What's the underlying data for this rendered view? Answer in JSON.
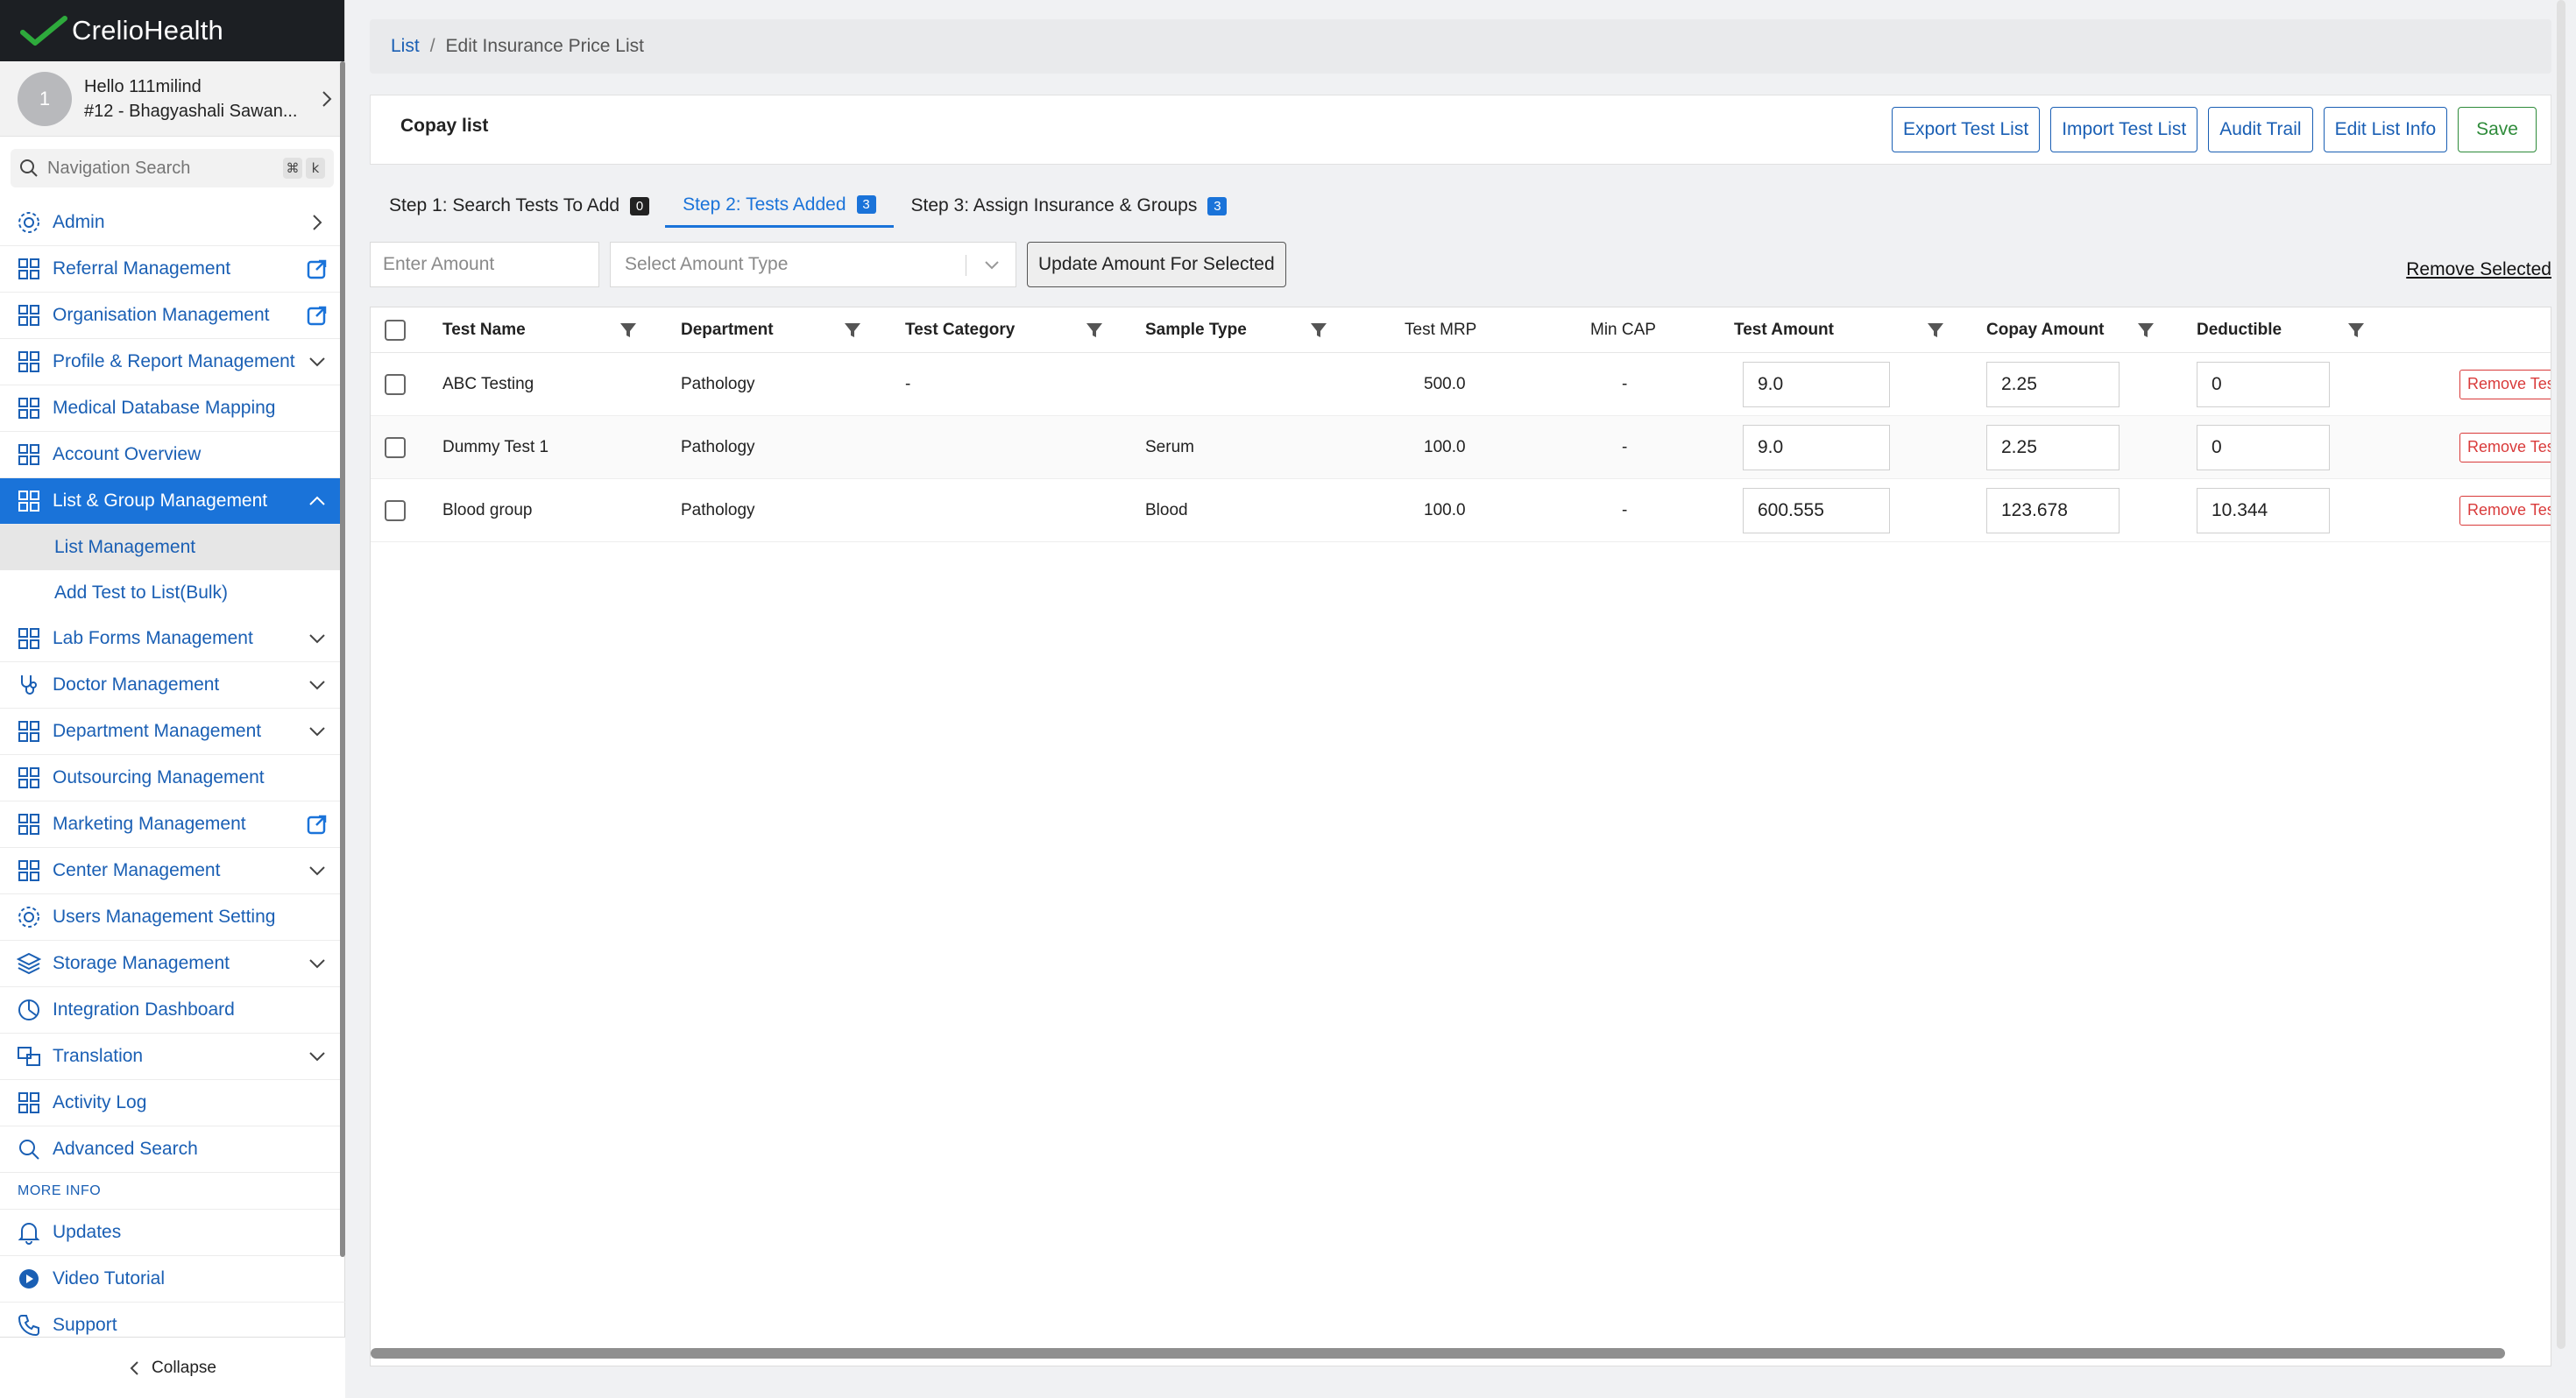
{
  "app": {
    "brand_name": "CrelioHealth",
    "brand_color": "#2eaa3c",
    "accent_color": "#1a73d9"
  },
  "user": {
    "avatar_initial": "1",
    "greeting": "Hello 111milind",
    "center": "#12 - Bhagyashali Sawan..."
  },
  "nav_search": {
    "placeholder": "Navigation Search",
    "key1": "⌘",
    "key2": "k"
  },
  "sidebar": {
    "items": [
      {
        "label": "Admin",
        "icon": "gear-icon",
        "trail": "chevron-right"
      },
      {
        "label": "Referral Management",
        "icon": "grid-icon",
        "trail": "external-link"
      },
      {
        "label": "Organisation Management",
        "icon": "grid-icon",
        "trail": "external-link"
      },
      {
        "label": "Profile & Report Management",
        "icon": "grid-icon",
        "trail": "chevron-down"
      },
      {
        "label": "Medical Database Mapping",
        "icon": "grid-icon",
        "trail": ""
      },
      {
        "label": "Account Overview",
        "icon": "grid-icon",
        "trail": ""
      },
      {
        "label": "List & Group Management",
        "icon": "grid-icon",
        "trail": "chevron-up"
      }
    ],
    "sub_items": [
      {
        "label": "List Management"
      },
      {
        "label": "Add Test to List(Bulk)"
      }
    ],
    "items2": [
      {
        "label": "Lab Forms Management",
        "icon": "grid-icon",
        "trail": "chevron-down"
      },
      {
        "label": "Doctor Management",
        "icon": "stethoscope-icon",
        "trail": "chevron-down"
      },
      {
        "label": "Department Management",
        "icon": "grid-icon",
        "trail": "chevron-down"
      },
      {
        "label": "Outsourcing Management",
        "icon": "grid-icon",
        "trail": ""
      },
      {
        "label": "Marketing Management",
        "icon": "grid-icon",
        "trail": "external-link"
      },
      {
        "label": "Center Management",
        "icon": "grid-icon",
        "trail": "chevron-down"
      },
      {
        "label": "Users Management Setting",
        "icon": "gear-icon",
        "trail": ""
      },
      {
        "label": "Storage Management",
        "icon": "layers-icon",
        "trail": "chevron-down"
      },
      {
        "label": "Integration Dashboard",
        "icon": "dashboard-icon",
        "trail": ""
      },
      {
        "label": "Translation",
        "icon": "translate-icon",
        "trail": "chevron-down"
      },
      {
        "label": "Activity Log",
        "icon": "grid-icon",
        "trail": ""
      },
      {
        "label": "Advanced Search",
        "icon": "search-icon",
        "trail": ""
      }
    ],
    "more_info_label": "MORE INFO",
    "more_items": [
      {
        "label": "Updates",
        "icon": "bell-icon"
      },
      {
        "label": "Video Tutorial",
        "icon": "play-icon"
      },
      {
        "label": "Support",
        "icon": "phone-icon"
      }
    ],
    "collapse_label": "Collapse"
  },
  "breadcrumb": {
    "link": "List",
    "separator": "/",
    "current": "Edit Insurance Price List"
  },
  "header": {
    "title": "Copay list",
    "buttons": {
      "export": "Export Test List",
      "import": "Import Test List",
      "audit": "Audit Trail",
      "edit": "Edit List Info",
      "save": "Save"
    }
  },
  "tabs": [
    {
      "label": "Step 1: Search Tests To Add",
      "badge": "0"
    },
    {
      "label": "Step 2: Tests Added",
      "badge": "3"
    },
    {
      "label": "Step 3: Assign Insurance & Groups",
      "badge": "3"
    }
  ],
  "toolbar": {
    "amount_placeholder": "Enter Amount",
    "amount_type_placeholder": "Select Amount Type",
    "update_label": "Update Amount For Selected",
    "remove_selected_label": "Remove Selected"
  },
  "table": {
    "headers": {
      "test_name": "Test Name",
      "department": "Department",
      "test_category": "Test Category",
      "sample_type": "Sample Type",
      "test_mrp": "Test MRP",
      "min_cap": "Min CAP",
      "test_amount": "Test Amount",
      "copay_amount": "Copay Amount",
      "deductible": "Deductible"
    },
    "remove_label": "Remove Test",
    "rows": [
      {
        "name": "ABC Testing",
        "department": "Pathology",
        "category": "-",
        "sample": "",
        "mrp": "500.0",
        "min_cap": "-",
        "test_amount": "9.0",
        "copay_amount": "2.25",
        "deductible": "0"
      },
      {
        "name": "Dummy Test 1",
        "department": "Pathology",
        "category": "",
        "sample": "Serum",
        "mrp": "100.0",
        "min_cap": "-",
        "test_amount": "9.0",
        "copay_amount": "2.25",
        "deductible": "0"
      },
      {
        "name": "Blood group",
        "department": "Pathology",
        "category": "",
        "sample": "Blood",
        "mrp": "100.0",
        "min_cap": "-",
        "test_amount": "600.555",
        "copay_amount": "123.678",
        "deductible": "10.344"
      }
    ]
  }
}
